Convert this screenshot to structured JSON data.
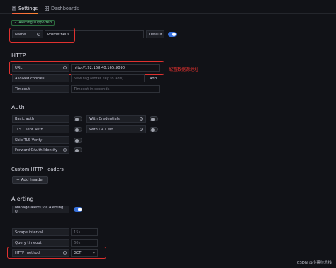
{
  "tabs": [
    {
      "label": "Settings",
      "icon": "sliders-icon",
      "active": true
    },
    {
      "label": "Dashboards",
      "icon": "apps-icon",
      "active": false
    }
  ],
  "alert_badge": "Alerting supported",
  "name_row": {
    "label": "Name",
    "value": "Prometheus",
    "default_label": "Default",
    "default_on": true
  },
  "http": {
    "title": "HTTP",
    "url": {
      "label": "URL",
      "value": "http://192.168.40.165:9090"
    },
    "url_annotation": "配置数据源地址",
    "allowed_cookies": {
      "label": "Allowed cookies",
      "placeholder": "New tag (enter key to add)",
      "add_label": "Add"
    },
    "timeout": {
      "label": "Timeout",
      "placeholder": "Timeout in seconds"
    }
  },
  "auth": {
    "title": "Auth",
    "basic_auth": "Basic auth",
    "with_credentials": "With Credentials",
    "tls_client_auth": "TLS Client Auth",
    "with_ca_cert": "With CA Cert",
    "skip_tls_verify": "Skip TLS Verify",
    "forward_oauth": "Forward OAuth Identity"
  },
  "custom_headers": {
    "title": "Custom HTTP Headers",
    "add_label": "Add header"
  },
  "alerting": {
    "title": "Alerting",
    "manage_alerts": "Manage alerts via Alerting UI",
    "manage_on": true
  },
  "scrape_interval": {
    "label": "Scrape interval",
    "placeholder": "15s"
  },
  "query_timeout": {
    "label": "Query timeout",
    "placeholder": "60s"
  },
  "http_method": {
    "label": "HTTP method",
    "value": "GET"
  },
  "watermark": "CSDN @小蔡技术栈",
  "colors": {
    "accent": "#3871dc",
    "annotation": "#e0312f",
    "background": "#111217"
  }
}
